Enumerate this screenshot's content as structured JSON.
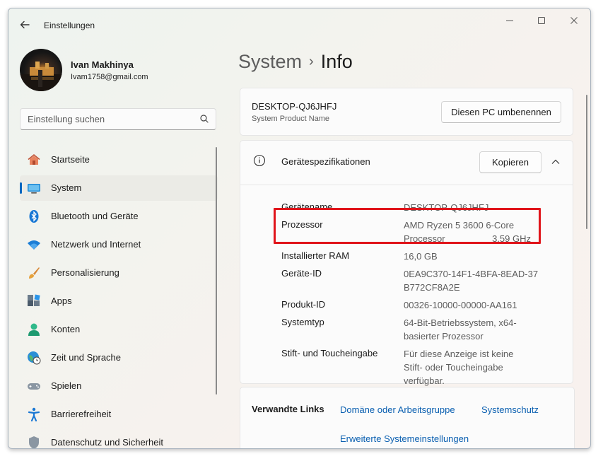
{
  "app": {
    "title": "Einstellungen"
  },
  "profile": {
    "name": "Ivan Makhinya",
    "email": "Ivam1758@gmail.com"
  },
  "search": {
    "placeholder": "Einstellung suchen"
  },
  "nav": {
    "items": [
      {
        "label": "Startseite",
        "icon": "home-icon"
      },
      {
        "label": "System",
        "icon": "monitor-icon",
        "active": true
      },
      {
        "label": "Bluetooth und Geräte",
        "icon": "bluetooth-icon"
      },
      {
        "label": "Netzwerk und Internet",
        "icon": "wifi-icon"
      },
      {
        "label": "Personalisierung",
        "icon": "brush-icon"
      },
      {
        "label": "Apps",
        "icon": "apps-icon"
      },
      {
        "label": "Konten",
        "icon": "person-icon"
      },
      {
        "label": "Zeit und Sprache",
        "icon": "globe-clock-icon"
      },
      {
        "label": "Spielen",
        "icon": "gamepad-icon"
      },
      {
        "label": "Barrierefreiheit",
        "icon": "accessibility-icon"
      },
      {
        "label": "Datenschutz und Sicherheit",
        "icon": "shield-icon"
      }
    ]
  },
  "breadcrumb": {
    "parent": "System",
    "separator": "›",
    "current": "Info"
  },
  "device": {
    "name": "DESKTOP-QJ6JHFJ",
    "subtitle": "System Product Name",
    "rename_label": "Diesen PC umbenennen"
  },
  "specs": {
    "title": "Gerätespezifikationen",
    "copy_label": "Kopieren",
    "rows": [
      {
        "label": "Gerätename",
        "value": [
          "DESKTOP-QJ6JHFJ"
        ]
      },
      {
        "label": "Prozessor",
        "value": [
          "AMD Ryzen 5 3600 6-Core",
          "Processor",
          "3.59 GHz"
        ]
      },
      {
        "label": "Installierter RAM",
        "value": [
          "16,0 GB"
        ]
      },
      {
        "label": "Geräte-ID",
        "value": [
          "0EA9C370-14F1-4BFA-8EAD-37",
          "B772CF8A2E"
        ]
      },
      {
        "label": "Produkt-ID",
        "value": [
          "00326-10000-00000-AA161"
        ]
      },
      {
        "label": "Systemtyp",
        "value": [
          "64-Bit-Betriebssystem, x64-",
          "basierter Prozessor"
        ]
      },
      {
        "label": "Stift- und Toucheingabe",
        "value": [
          "Für diese Anzeige ist keine",
          "Stift- oder Toucheingabe",
          "verfügbar."
        ]
      }
    ]
  },
  "related": {
    "label": "Verwandte Links",
    "links": [
      "Domäne oder Arbeitsgruppe",
      "Systemschutz",
      "Erweiterte Systemeinstellungen"
    ]
  },
  "colors": {
    "accent": "#0067c0",
    "link": "#0a5fb0",
    "highlight": "#e0141a"
  }
}
